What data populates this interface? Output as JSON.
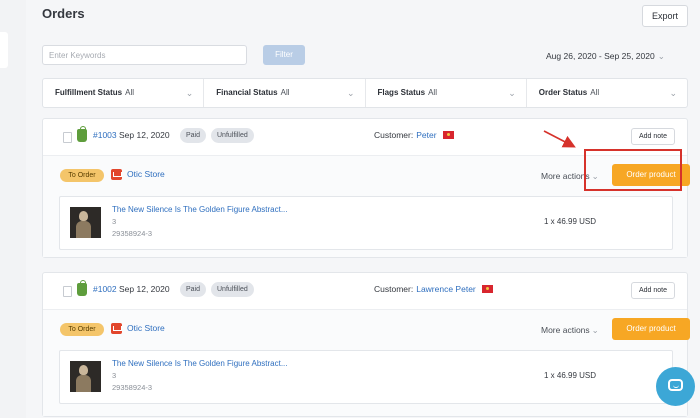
{
  "header": {
    "title": "Orders",
    "export_label": "Export"
  },
  "toolbar": {
    "search_placeholder": "Enter Keywords",
    "filter_label": "Filter",
    "date_range": "Aug 26, 2020 - Sep 25, 2020"
  },
  "filters": [
    {
      "label": "Fulfillment Status",
      "value": "All"
    },
    {
      "label": "Financial Status",
      "value": "All"
    },
    {
      "label": "Flags Status",
      "value": "All"
    },
    {
      "label": "Order Status",
      "value": "All"
    }
  ],
  "orders": [
    {
      "number": "#1003",
      "date": "Sep 12, 2020",
      "payment": "Paid",
      "fulfillment": "Unfulfilled",
      "customer_label": "Customer:",
      "customer": "Peter",
      "add_note": "Add note",
      "status": "To Order",
      "store": "Otic Store",
      "more_actions": "More actions",
      "order_button": "Order product",
      "item": {
        "title": "The New Silence Is The Golden Figure Abstract...",
        "qty": "3",
        "sku": "29358924-3",
        "price": "1 x 46.99 USD"
      }
    },
    {
      "number": "#1002",
      "date": "Sep 12, 2020",
      "payment": "Paid",
      "fulfillment": "Unfulfilled",
      "customer_label": "Customer:",
      "customer": "Lawrence Peter",
      "add_note": "Add note",
      "status": "To Order",
      "store": "Otic Store",
      "more_actions": "More actions",
      "order_button": "Order product",
      "item": {
        "title": "The New Silence Is The Golden Figure Abstract...",
        "qty": "3",
        "sku": "29358924-3",
        "price": "1 x 46.99 USD"
      }
    }
  ],
  "icons": {
    "shopify": "shopify-bag-icon",
    "store": "store-icon",
    "flag": "flag-icon",
    "country": "vietnam-flag-icon",
    "chat": "chat-icon",
    "chevron": "chevron-down-icon"
  },
  "colors": {
    "accent": "#f7a724",
    "link": "#2f6fbf",
    "highlight": "#d6322b",
    "chat": "#3ca7d6"
  }
}
